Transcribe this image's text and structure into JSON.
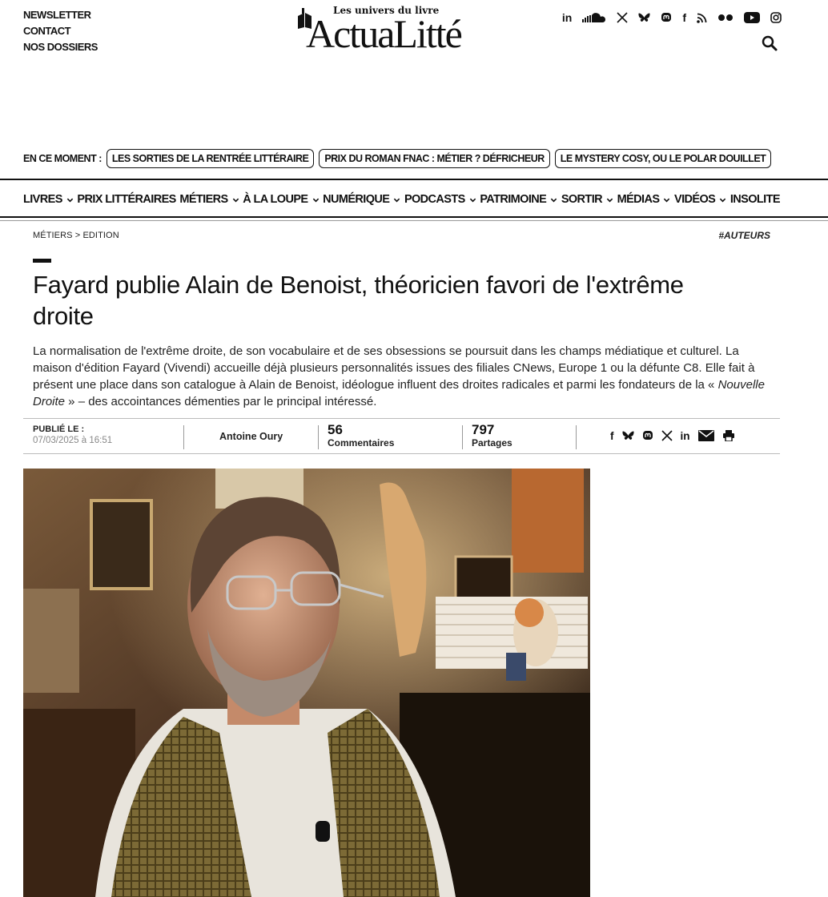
{
  "top_links": [
    "NEWSLETTER",
    "CONTACT",
    "NOS DOSSIERS"
  ],
  "logo": {
    "tagline": "Les univers du livre",
    "wordmark": "ActuaLitté"
  },
  "social_icons": [
    "linkedin-icon",
    "soundcloud-icon",
    "x-icon",
    "bluesky-icon",
    "mastodon-icon",
    "facebook-icon",
    "rss-icon",
    "flickr-icon",
    "youtube-icon",
    "instagram-icon"
  ],
  "moment": {
    "label": "EN CE MOMENT :",
    "items": [
      "LES SORTIES DE LA RENTRÉE LITTÉRAIRE",
      "PRIX DU ROMAN FNAC : MÉTIER ? DÉFRICHEUR",
      "LE MYSTERY COSY, OU LE POLAR DOUILLET"
    ]
  },
  "nav": [
    {
      "label": "LIVRES",
      "dropdown": true
    },
    {
      "label": "PRIX LITTÉRAIRES",
      "dropdown": false
    },
    {
      "label": "MÉTIERS",
      "dropdown": true
    },
    {
      "label": "À LA LOUPE",
      "dropdown": true
    },
    {
      "label": "NUMÉRIQUE",
      "dropdown": true
    },
    {
      "label": "PODCASTS",
      "dropdown": true
    },
    {
      "label": "PATRIMOINE",
      "dropdown": true
    },
    {
      "label": "SORTIR",
      "dropdown": true
    },
    {
      "label": "MÉDIAS",
      "dropdown": true
    },
    {
      "label": "VIDÉOS",
      "dropdown": true
    },
    {
      "label": "INSOLITE",
      "dropdown": false
    }
  ],
  "breadcrumb": {
    "section": "MÉTIERS",
    "separator": ">",
    "subsection": "EDITION"
  },
  "hashtag": "#AUTEURS",
  "article": {
    "title": "Fayard publie Alain de Benoist, théoricien favori de l'extrême droite",
    "lede_before": "La normalisation de l'extrême droite, de son vocabulaire et de ses obsessions se poursuit dans les champs médiatique et culturel. La maison d'édition Fayard (Vivendi) accueille déjà plusieurs personnalités issues des filiales CNews, Europe 1 ou la défunte C8. Elle fait à présent une place dans son catalogue à Alain de Benoist, idéologue influent des droites radicales et parmi les fondateurs de la « ",
    "lede_em": "Nouvelle Droite",
    "lede_after": " » – des accointances démenties par le principal intéressé."
  },
  "meta": {
    "published_label": "PUBLIÉ LE :",
    "published_date": "07/03/2025 à 16:51",
    "author": "Antoine Oury",
    "comments_count": "56",
    "comments_label": "Commentaires",
    "shares_count": "797",
    "shares_label": "Partages"
  },
  "share_icons": [
    "facebook-share-icon",
    "bluesky-share-icon",
    "mastodon-share-icon",
    "x-share-icon",
    "linkedin-share-icon",
    "email-share-icon",
    "print-icon"
  ],
  "colors": {
    "text": "#111111",
    "muted": "#888888",
    "rule": "#bbbbbb"
  }
}
